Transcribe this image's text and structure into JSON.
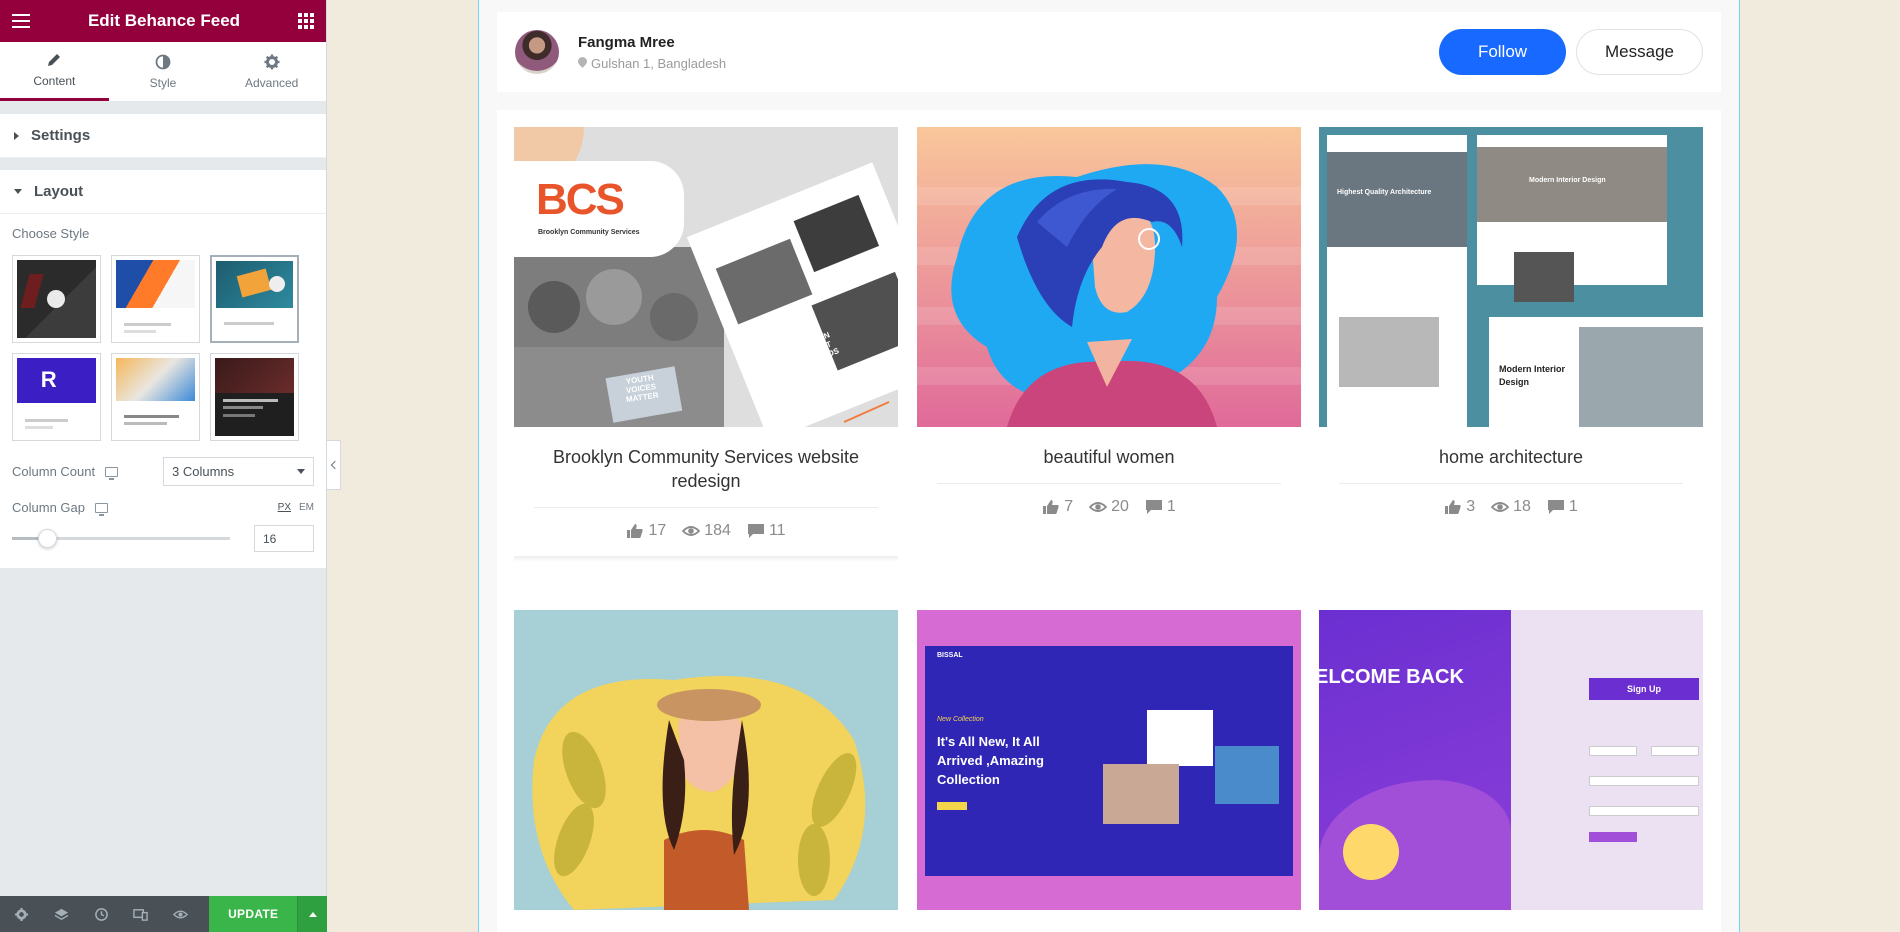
{
  "panel": {
    "title": "Edit Behance Feed",
    "tabs": [
      {
        "label": "Content",
        "icon": "pencil-icon"
      },
      {
        "label": "Style",
        "icon": "contrast-icon"
      },
      {
        "label": "Advanced",
        "icon": "gear-icon"
      }
    ],
    "settings_label": "Settings",
    "layout_label": "Layout",
    "choose_style_label": "Choose Style",
    "column_count_label": "Column Count",
    "column_count_value": "3 Columns",
    "column_gap_label": "Column Gap",
    "unit_px": "PX",
    "unit_em": "EM",
    "column_gap_value": "16",
    "column_gap_slider_fraction": 0.16,
    "update_label": "UPDATE"
  },
  "profile": {
    "name": "Fangma Mree",
    "location": "Gulshan 1, Bangladesh",
    "follow_label": "Follow",
    "message_label": "Message"
  },
  "projects": [
    {
      "title": "Brooklyn Community Services website redesign",
      "likes": "17",
      "views": "184",
      "comments": "11"
    },
    {
      "title": "beautiful women",
      "likes": "7",
      "views": "20",
      "comments": "1"
    },
    {
      "title": "home architecture",
      "likes": "3",
      "views": "18",
      "comments": "1"
    }
  ],
  "project_images": {
    "bcs_logo": "BCS",
    "bcs_sub": "Brooklyn Community Services",
    "bcs_sign1": "YOUTH VOICES MATTER",
    "bcs_sign2": "HUMAN SPIRIT AWARDS",
    "arch_h1": "Highest Quality Architecture",
    "arch_h2": "Modern Interior Design",
    "arch_h3": "Modern Interior Design",
    "fashion_brand": "BISSAL",
    "fashion_small": "New Collection",
    "fashion_headline": "It's All New, It All Arrived ,Amazing Collection",
    "signup_welcome": "ELCOME BACK",
    "signup_button": "Sign Up"
  },
  "colors": {
    "brand": "#93003c",
    "follow": "#1769ff",
    "update": "#39b54a",
    "preview_border": "#71d7f7"
  }
}
